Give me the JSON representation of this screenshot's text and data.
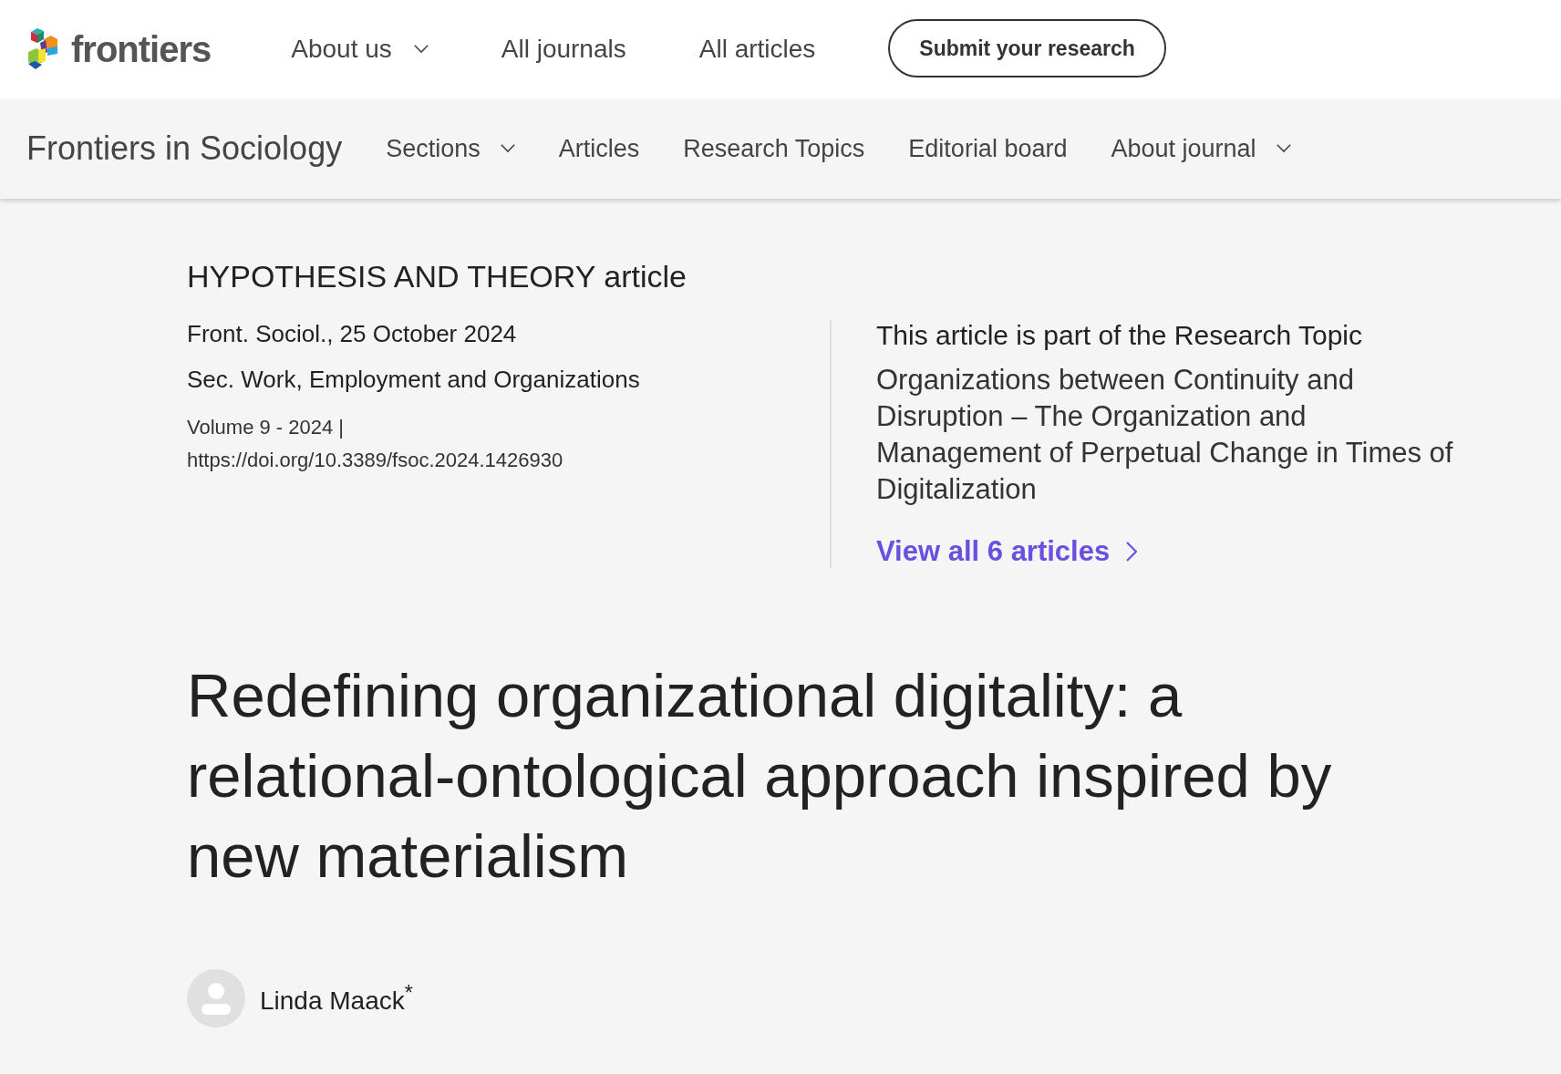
{
  "top_nav": {
    "logo_text": "frontiers",
    "items": [
      {
        "label": "About us",
        "has_menu": true
      },
      {
        "label": "All journals",
        "has_menu": false
      },
      {
        "label": "All articles",
        "has_menu": false
      }
    ],
    "submit_button": "Submit your research"
  },
  "journal_nav": {
    "title": "Frontiers in Sociology",
    "items": [
      {
        "label": "Sections",
        "has_menu": true
      },
      {
        "label": "Articles",
        "has_menu": false
      },
      {
        "label": "Research Topics",
        "has_menu": false
      },
      {
        "label": "Editorial board",
        "has_menu": false
      },
      {
        "label": "About journal",
        "has_menu": true
      }
    ]
  },
  "article": {
    "type": "HYPOTHESIS AND THEORY article",
    "citation": "Front. Sociol., 25 October 2024",
    "section": "Sec. Work, Employment and Organizations",
    "volume": "Volume 9 - 2024 |",
    "doi": "https://doi.org/10.3389/fsoc.2024.1426930",
    "research_topic": {
      "heading": "This article is part of the Research Topic",
      "name": "Organizations between Continuity and Disruption – The Organization and Management of Perpetual Change in Times of Digitalization",
      "link": "View all 6 articles"
    },
    "title": "Redefining organizational digitality: a relational-ontological approach inspired by new materialism",
    "authors": [
      {
        "name": "Linda Maack",
        "note": "*"
      }
    ]
  }
}
